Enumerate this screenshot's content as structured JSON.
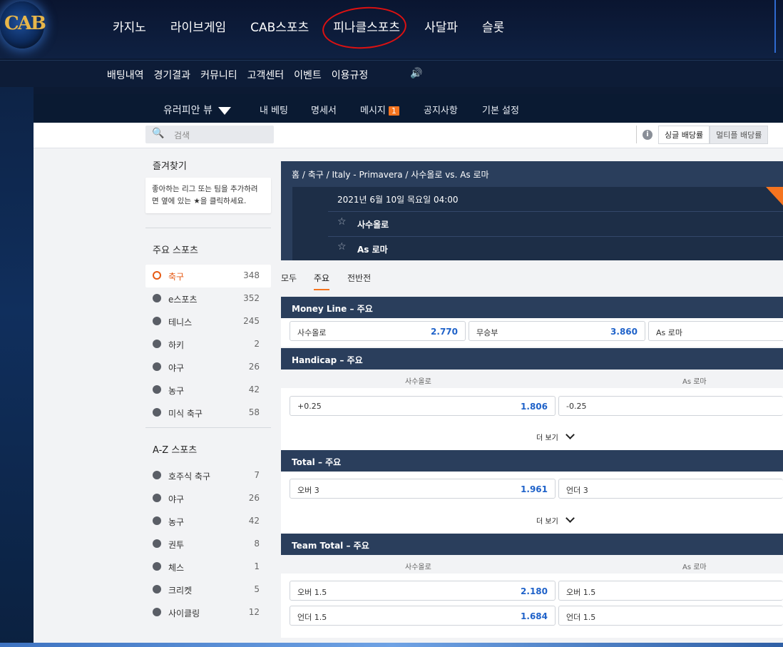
{
  "logo_text": "CAB",
  "top_nav": [
    "카지노",
    "라이브게임",
    "CAB스포츠",
    "피나클스포츠",
    "사달파",
    "슬롯"
  ],
  "sub_nav": [
    "배팅내역",
    "경기결과",
    "커뮤니티",
    "고객센터",
    "이벤트",
    "이용규정"
  ],
  "sports_nav": {
    "view": "유러피안 뷰",
    "items": [
      "내 베팅",
      "명세서",
      "메시지",
      "공지사항",
      "기본 설정"
    ],
    "message_badge": "1"
  },
  "search": {
    "placeholder": "검색"
  },
  "odds_toggle": {
    "single": "싱글 배당률",
    "multi": "멀티플 배당률"
  },
  "sidebar": {
    "fav_title": "즐겨찾기",
    "fav_text": "좋아하는 리그 또는 팀을 추가하려면 옆에 있는 ★을 클릭하세요.",
    "main_title": "주요 스포츠",
    "main_sports": [
      {
        "name": "축구",
        "count": "348"
      },
      {
        "name": "e스포츠",
        "count": "352"
      },
      {
        "name": "테니스",
        "count": "245"
      },
      {
        "name": "하키",
        "count": "2"
      },
      {
        "name": "야구",
        "count": "26"
      },
      {
        "name": "농구",
        "count": "42"
      },
      {
        "name": "미식 축구",
        "count": "58"
      }
    ],
    "az_title": "A-Z 스포츠",
    "az_sports": [
      {
        "name": "호주식 축구",
        "count": "7"
      },
      {
        "name": "야구",
        "count": "26"
      },
      {
        "name": "농구",
        "count": "42"
      },
      {
        "name": "권투",
        "count": "8"
      },
      {
        "name": "체스",
        "count": "1"
      },
      {
        "name": "크리켓",
        "count": "5"
      },
      {
        "name": "사이클링",
        "count": "12"
      }
    ]
  },
  "event": {
    "breadcrumb": "홈 / 축구 / Italy - Primavera / 사수올로 vs. As 로마",
    "datetime": "2021년 6월 10일 목요일 04:00",
    "home": "사수올로",
    "away": "As 로마"
  },
  "tabs": [
    "모두",
    "주요",
    "전반전"
  ],
  "markets": {
    "money_line": {
      "title": "Money Line – 주요",
      "home": {
        "label": "사수올로",
        "odds": "2.770"
      },
      "draw": {
        "label": "무승부",
        "odds": "3.860"
      },
      "away": {
        "label": "As 로마"
      }
    },
    "handicap": {
      "title": "Handicap – 주요",
      "col_home": "사수올로",
      "col_away": "As 로마",
      "home": {
        "label": "+0.25",
        "odds": "1.806"
      },
      "away": {
        "label": "-0.25"
      }
    },
    "total": {
      "title": "Total – 주요",
      "over": {
        "label": "오버 3",
        "odds": "1.961"
      },
      "under": {
        "label": "언더 3"
      }
    },
    "team_total": {
      "title": "Team Total – 주요",
      "col_home": "사수올로",
      "col_away": "As 로마",
      "home_over": {
        "label": "오버 1.5",
        "odds": "2.180"
      },
      "home_under": {
        "label": "언더 1.5",
        "odds": "1.684"
      },
      "away_over": {
        "label": "오버 1.5"
      },
      "away_under": {
        "label": "언더 1.5"
      }
    },
    "more_label": "더 보기"
  },
  "colors": {
    "accent": "#f5741f",
    "odds": "#1f62c9",
    "header": "#2a3e5c"
  }
}
